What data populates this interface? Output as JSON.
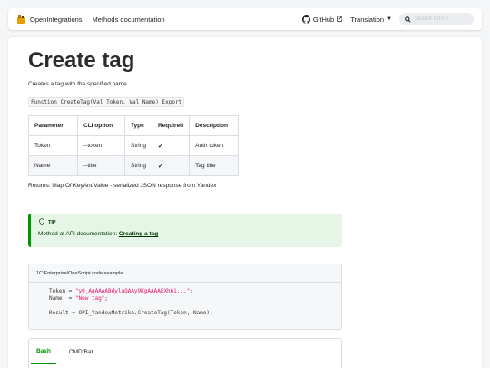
{
  "navbar": {
    "brand": "OpenIntegrations",
    "methods_link": "Methods documentation",
    "github_label": "GitHub",
    "translation_label": "Translation",
    "search_placeholder": "Search Ctrl+K"
  },
  "page": {
    "title": "Create tag",
    "description": "Creates a tag with the specified name",
    "signature": "Function CreateTag(Val Token, Val Name) Export",
    "returns": "Returns: Map Of KeyAndValue - serialized JSON response from Yandex"
  },
  "params_table": {
    "headers": [
      "Parameter",
      "CLI option",
      "Type",
      "Required",
      "Description"
    ],
    "rows": [
      [
        "Token",
        "--token",
        "String",
        "✔",
        "Auth token"
      ],
      [
        "Name",
        "--title",
        "String",
        "✔",
        "Tag title"
      ]
    ]
  },
  "tip": {
    "heading": "TIP",
    "text": "Method at API documentation: ",
    "link": "Creating a tag"
  },
  "code_example": {
    "title": "1C:Enterprise/OneScript code example",
    "line1_prefix": "Token = ",
    "line1_value": "\"y0_AgAAAABdylaOAAy9KgAAAAEXh6i...\"",
    "line1_suffix": ";",
    "line2_prefix": "Name  = ",
    "line2_value": "\"New tag\"",
    "line2_suffix": ";",
    "line3": "Result = OPI_YandexMetrika.CreateTag(Token, Name);"
  },
  "tabs": [
    "Bash",
    "CMD/Bat"
  ],
  "colors": {
    "accent": "#009400",
    "tip_bg": "#e6f6e6",
    "code_string": "#e3116c"
  }
}
